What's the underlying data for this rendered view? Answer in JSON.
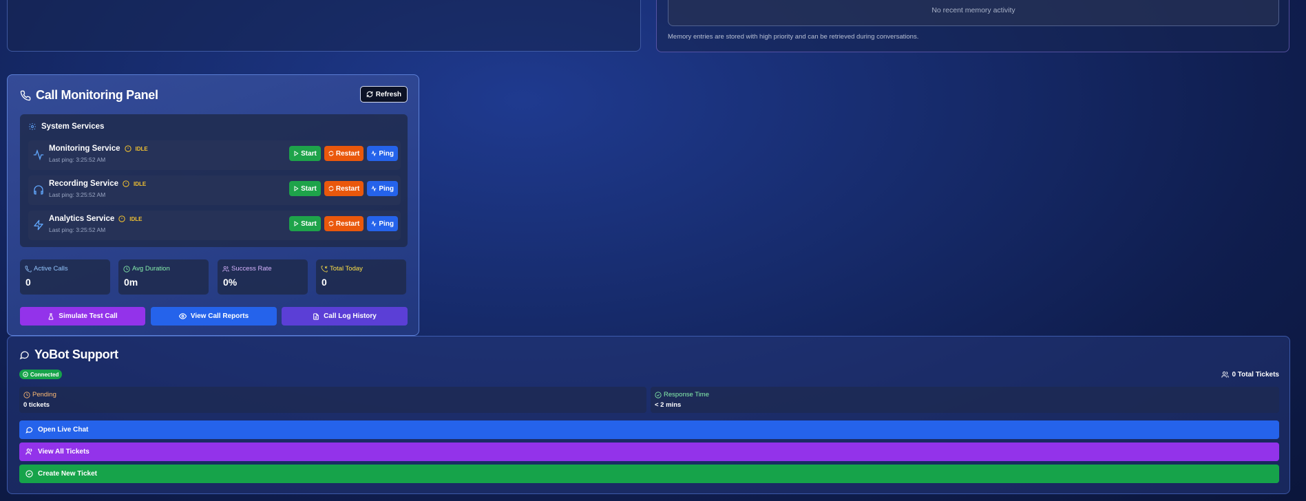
{
  "memory": {
    "empty_text": "No recent memory activity",
    "note": "Memory entries are stored with high priority and can be retrieved during conversations."
  },
  "call_panel": {
    "title": "Call Monitoring Panel",
    "refresh_label": "Refresh",
    "services_title": "System Services",
    "services": [
      {
        "name": "Monitoring Service",
        "status": "IDLE",
        "last_ping": "Last ping: 3:25:52 AM",
        "icon": "activity-icon"
      },
      {
        "name": "Recording Service",
        "status": "IDLE",
        "last_ping": "Last ping: 3:25:52 AM",
        "icon": "headphones-icon"
      },
      {
        "name": "Analytics Service",
        "status": "IDLE",
        "last_ping": "Last ping: 3:25:52 AM",
        "icon": "zap-icon"
      }
    ],
    "service_buttons": {
      "start": "Start",
      "restart": "Restart",
      "ping": "Ping"
    },
    "stats": [
      {
        "label": "Active Calls",
        "value": "0",
        "color": "#93c5fd"
      },
      {
        "label": "Avg Duration",
        "value": "0m",
        "color": "#86efac"
      },
      {
        "label": "Success Rate",
        "value": "0%",
        "color": "#d8b4fe"
      },
      {
        "label": "Total Today",
        "value": "0",
        "color": "#fde047"
      }
    ],
    "actions": {
      "simulate": "Simulate Test Call",
      "reports": "View Call Reports",
      "history": "Call Log History"
    }
  },
  "support": {
    "title": "YoBot Support",
    "connected": "Connected",
    "total_tickets": "0 Total Tickets",
    "pending_label": "Pending",
    "pending_value": "0 tickets",
    "response_label": "Response Time",
    "response_value": "< 2 mins",
    "buttons": {
      "live_chat": "Open Live Chat",
      "view_tickets": "View All Tickets",
      "create_ticket": "Create New Ticket"
    }
  },
  "colors": {
    "purple": "#9333ea",
    "blue": "#2563eb",
    "green": "#16a34a",
    "orange": "#ea580c",
    "idle": "#f2c230"
  }
}
